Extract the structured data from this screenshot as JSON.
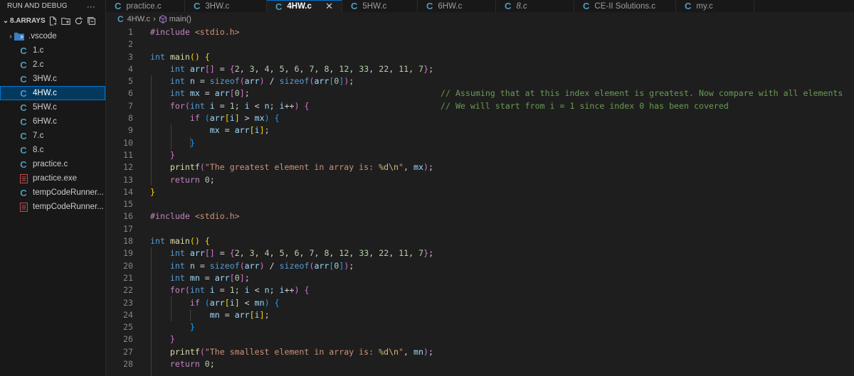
{
  "sidebar": {
    "header": "RUN AND DEBUG",
    "more": "···",
    "folder": "8.ARRAYS",
    "items": [
      {
        "label": ".vscode",
        "kind": "folder"
      },
      {
        "label": "1.c",
        "kind": "c"
      },
      {
        "label": "2.c",
        "kind": "c"
      },
      {
        "label": "3HW.c",
        "kind": "c"
      },
      {
        "label": "4HW.c",
        "kind": "c",
        "selected": true
      },
      {
        "label": "5HW.c",
        "kind": "c"
      },
      {
        "label": "6HW.c",
        "kind": "c"
      },
      {
        "label": "7.c",
        "kind": "c"
      },
      {
        "label": "8.c",
        "kind": "c"
      },
      {
        "label": "practice.c",
        "kind": "c"
      },
      {
        "label": "practice.exe",
        "kind": "exe"
      },
      {
        "label": "tempCodeRunner...",
        "kind": "c"
      },
      {
        "label": "tempCodeRunner...",
        "kind": "exe"
      }
    ]
  },
  "tabs": [
    {
      "label": "practice.c"
    },
    {
      "label": "3HW.c"
    },
    {
      "label": "4HW.c",
      "active": true,
      "close": "✕"
    },
    {
      "label": "5HW.c"
    },
    {
      "label": "6HW.c"
    },
    {
      "label": "8.c",
      "italic": true
    },
    {
      "label": "CE-II Solutions.c"
    },
    {
      "label": "my.c"
    }
  ],
  "breadcrumb": {
    "file": "4HW.c",
    "symbol": "main()"
  },
  "editor": {
    "line_numbers": [
      "1",
      "2",
      "3",
      "4",
      "5",
      "6",
      "7",
      "8",
      "9",
      "10",
      "11",
      "12",
      "13",
      "14",
      "15",
      "16",
      "17",
      "18",
      "19",
      "20",
      "21",
      "22",
      "23",
      "24",
      "25",
      "26",
      "27",
      "28"
    ],
    "lines": [
      "#include <stdio.h>",
      "",
      "int main() {",
      "    int arr[] = {2, 3, 4, 5, 6, 7, 8, 12, 33, 22, 11, 7};",
      "    int n = sizeof(arr) / sizeof(arr[0]);",
      "    int mx = arr[0];",
      "    for(int i = 1; i < n; i++) {",
      "        if (arr[i] > mx) {",
      "            mx = arr[i];",
      "        }",
      "    }",
      "    printf(\"The greatest element in array is: %d\\n\", mx);",
      "    return 0;",
      "}",
      "",
      "#include <stdio.h>",
      "",
      "int main() {",
      "    int arr[] = {2, 3, 4, 5, 6, 7, 8, 12, 33, 22, 11, 7};",
      "    int n = sizeof(arr) / sizeof(arr[0]);",
      "    int mn = arr[0];",
      "    for(int i = 1; i < n; i++) {",
      "        if (arr[i] < mn) {",
      "            mn = arr[i];",
      "        }",
      "    }",
      "    printf(\"The smallest element in array is: %d\\n\", mn);",
      "    return 0;"
    ],
    "comments": {
      "6": "// Assuming that at this index element is greatest. Now compare with all elements",
      "7": "// We will start from i = 1 since index 0 has been covered"
    }
  },
  "colors": {
    "accent": "#0078d4",
    "selection": "#04395e",
    "c_icon": "#519aba",
    "exe_icon": "#c74a4a",
    "comment": "#6a9955"
  }
}
